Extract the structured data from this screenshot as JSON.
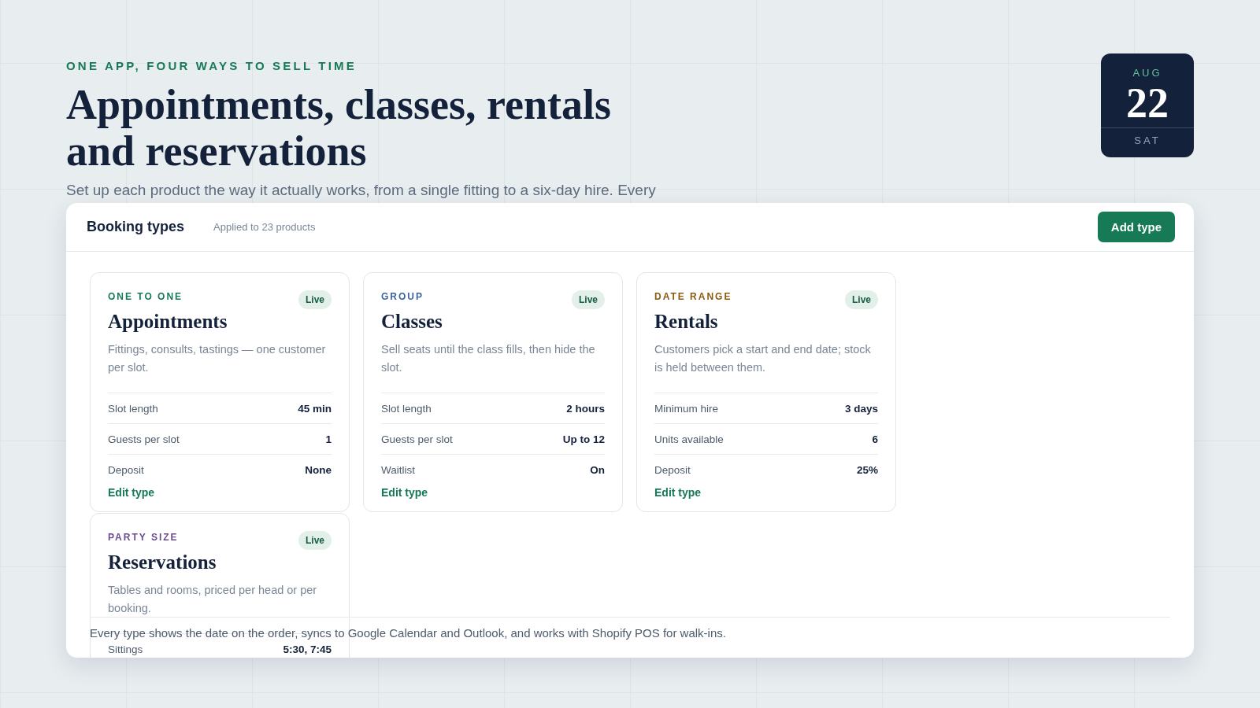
{
  "hero": {
    "eyebrow": "ONE APP, FOUR WAYS TO SELL TIME",
    "title_lines": [
      "Appointments, classes, rentals",
      "and reservations"
    ],
    "subtitle": "Set up each product the way it actually works, from a single fitting to a six-day hire. Every"
  },
  "date_badge": {
    "month": "AUG",
    "day": "22",
    "weekday": "SAT"
  },
  "panel": {
    "title": "Booking types",
    "meta": "Applied to 23 products",
    "button": "Add type",
    "cards": [
      {
        "category": "ONE TO ONE",
        "color": "#157a55",
        "status": "Live",
        "title": "Appointments",
        "description": "Fittings, consults, tastings — one customer per slot.",
        "rows": [
          {
            "label": "Slot length",
            "value": "45 min"
          },
          {
            "label": "Guests per slot",
            "value": "1"
          },
          {
            "label": "Deposit",
            "value": "None"
          }
        ],
        "link": "Edit type"
      },
      {
        "category": "GROUP",
        "color": "#3d64a0",
        "status": "Live",
        "title": "Classes",
        "description": "Sell seats until the class fills, then hide the slot.",
        "rows": [
          {
            "label": "Slot length",
            "value": "2 hours"
          },
          {
            "label": "Guests per slot",
            "value": "Up to 12"
          },
          {
            "label": "Waitlist",
            "value": "On"
          }
        ],
        "link": "Edit type"
      },
      {
        "category": "DATE RANGE",
        "color": "#8a5a10",
        "status": "Live",
        "title": "Rentals",
        "description": "Customers pick a start and end date; stock is held between them.",
        "rows": [
          {
            "label": "Minimum hire",
            "value": "3 days"
          },
          {
            "label": "Units available",
            "value": "6"
          },
          {
            "label": "Deposit",
            "value": "25%"
          }
        ],
        "link": "Edit type"
      },
      {
        "category": "PARTY SIZE",
        "color": "#6b4a90",
        "status": "Live",
        "title": "Reservations",
        "description": "Tables and rooms, priced per head or per booking.",
        "rows": [
          {
            "label": "Sittings",
            "value": "5:30, 7:45"
          }
        ]
      }
    ],
    "footer": "Every type shows the date on the order, syncs to Google Calendar and Outlook, and works with Shopify POS for walk-ins."
  }
}
